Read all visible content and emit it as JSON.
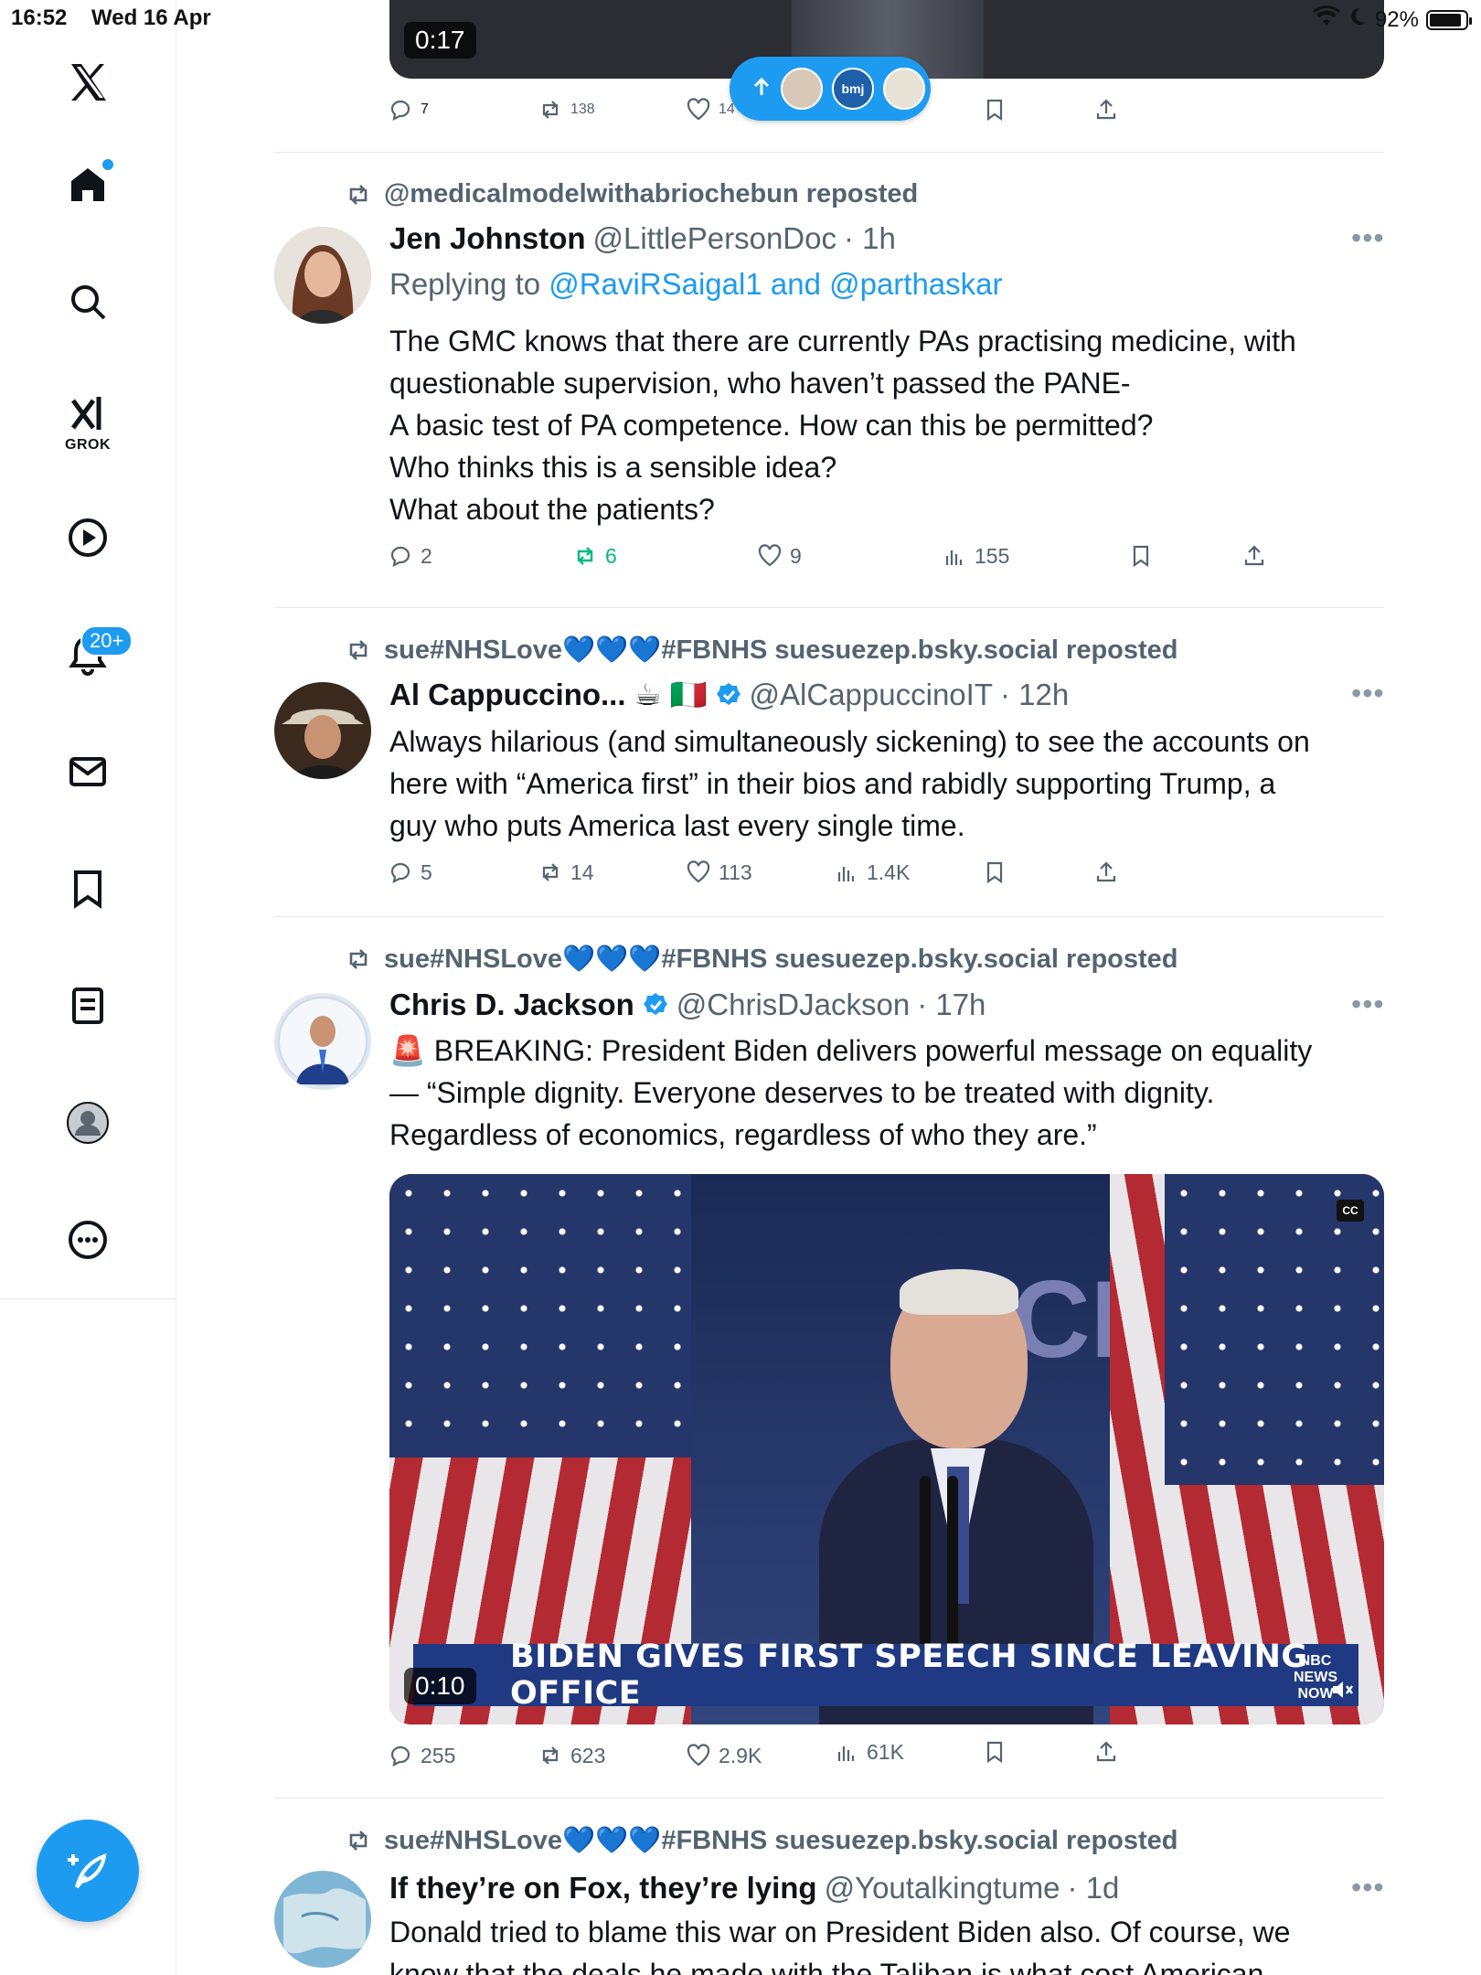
{
  "status_bar": {
    "time": "16:52",
    "date": "Wed 16 Apr",
    "battery": "92%"
  },
  "sidebar": {
    "grok_label": "GROK",
    "notifications_badge": "20+"
  },
  "top_tweet": {
    "video_timer": "0:17",
    "pill_label": "bmj",
    "stats": {
      "replies": "7",
      "reposts": "138",
      "likes": "14"
    }
  },
  "tweets": [
    {
      "repost_line": "@medicalmodelwithabriochebun reposted",
      "name": "Jen Johnston",
      "handle": "@LittlePersonDoc",
      "time": "· 1h",
      "replying_prefix": "Replying to ",
      "replying_to": "@RaviRSaigal1 and @parthaskar",
      "text_lines": [
        "The GMC knows that there are currently PAs practising medicine, with",
        "questionable supervision, who haven’t passed the PANE-",
        "A basic test of PA competence. How can this be permitted?",
        "Who thinks this is a sensible idea?",
        "What about the patients?"
      ],
      "stats": {
        "replies": "2",
        "reposts": "6",
        "likes": "9",
        "views": "155"
      }
    },
    {
      "repost_line": "sue#NHSLove💙💙💙#FBNHS suesuezep.bsky.social reposted",
      "name": "Al Cappuccino... ☕ 🇮🇹",
      "handle": "@AlCappuccinoIT",
      "time": "· 12h",
      "text_lines": [
        "Always hilarious (and simultaneously sickening) to see the accounts on",
        "here with “America first” in their bios and rabidly supporting Trump, a",
        "guy who puts America last every single time."
      ],
      "stats": {
        "replies": "5",
        "reposts": "14",
        "likes": "113",
        "views": "1.4K"
      }
    },
    {
      "repost_line": "sue#NHSLove💙💙💙#FBNHS suesuezep.bsky.social reposted",
      "name": "Chris D. Jackson",
      "handle": "@ChrisDJackson",
      "time": "· 17h",
      "text_lines": [
        "🚨 BREAKING: President Biden delivers powerful message on equality",
        "— “Simple dignity. Everyone deserves to be treated with dignity.",
        "Regardless of economics, regardless of who they are.”"
      ],
      "video": {
        "timer": "0:10",
        "chyron": "BIDEN GIVES FIRST SPEECH SINCE LEAVING OFFICE",
        "backdrop_text": "CP",
        "logo_text": "NBC NEWS NOW",
        "cc": "CC"
      },
      "stats": {
        "replies": "255",
        "reposts": "623",
        "likes": "2.9K",
        "views": "61K"
      }
    },
    {
      "repost_line": "sue#NHSLove💙💙💙#FBNHS suesuezep.bsky.social reposted",
      "name": "If they’re on Fox, they’re lying",
      "handle": "@Youtalkingtume",
      "time": "· 1d",
      "text_lines": [
        "Donald tried to blame this war on President Biden also. Of course, we",
        "know that the deals he made with the Taliban is what cost American"
      ]
    }
  ],
  "colors": {
    "accent": "#1d9bf0",
    "text": "#0f1419",
    "muted": "#536471",
    "repost_green": "#00ba7c"
  }
}
